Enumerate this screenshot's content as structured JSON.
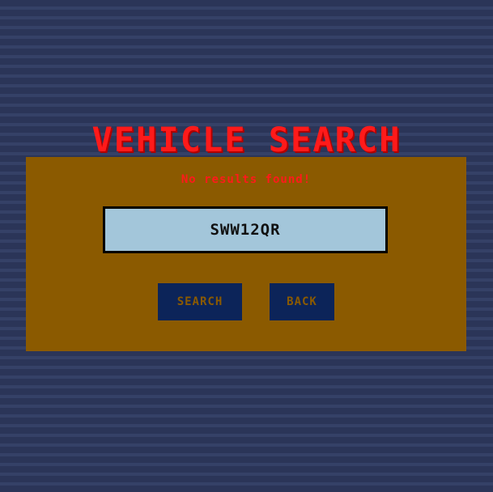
{
  "header": {
    "title": "VEHICLE SEARCH"
  },
  "search_panel": {
    "error_message": "No results found!",
    "plate_input": {
      "value": "SWW12QR"
    },
    "search_button_label": "SEARCH",
    "back_button_label": "BACK"
  },
  "colors": {
    "background": "#2b3558",
    "panel": "#8b5a00",
    "title_red": "#ff1a1a",
    "input_bg": "#a3c6da",
    "button_bg": "#0c2459"
  }
}
